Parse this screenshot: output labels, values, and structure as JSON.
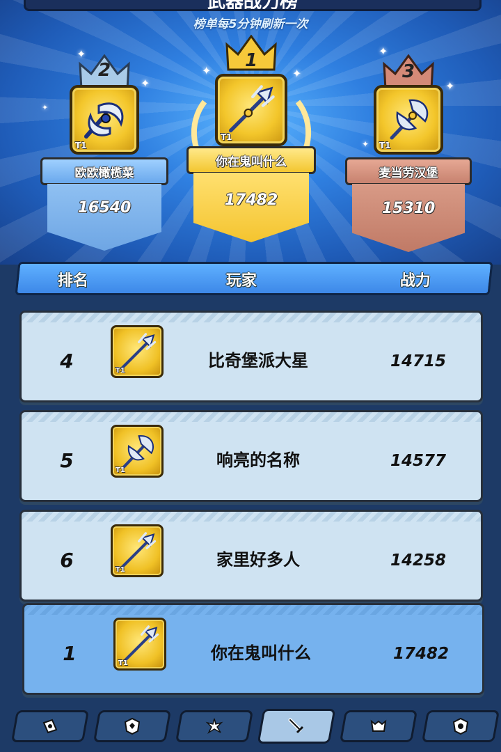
{
  "header": {
    "title": "武器战力榜",
    "subtitle": "榜单每5分钟刷新一次"
  },
  "podium": [
    {
      "rank": "2",
      "name": "欧欧橄榄菜",
      "power": "16540",
      "tier": "T1",
      "theme": "silver"
    },
    {
      "rank": "1",
      "name": "你在鬼叫什么",
      "power": "17482",
      "tier": "T1",
      "theme": "gold"
    },
    {
      "rank": "3",
      "name": "麦当劳汉堡",
      "power": "15310",
      "tier": "T1",
      "theme": "bronze"
    }
  ],
  "columns": {
    "rank": "排名",
    "player": "玩家",
    "power": "战力"
  },
  "rows": [
    {
      "rank": "4",
      "name": "比奇堡派大星",
      "power": "14715",
      "tier": "T1",
      "weapon_icon": "trident-icon"
    },
    {
      "rank": "5",
      "name": "响亮的名称",
      "power": "14577",
      "tier": "T1",
      "weapon_icon": "axe-icon"
    },
    {
      "rank": "6",
      "name": "家里好多人",
      "power": "14258",
      "tier": "T1",
      "weapon_icon": "trident-icon"
    }
  ],
  "my_row": {
    "rank": "1",
    "name": "你在鬼叫什么",
    "power": "17482",
    "tier": "T1",
    "weapon_icon": "trident-icon"
  },
  "tabs": [
    {
      "icon": "card-icon",
      "active": false
    },
    {
      "icon": "shield-badge-icon",
      "active": false
    },
    {
      "icon": "star-burst-icon",
      "active": false
    },
    {
      "icon": "sword-icon",
      "active": true
    },
    {
      "icon": "helmet-icon",
      "active": false
    },
    {
      "icon": "eye-badge-icon",
      "active": false
    }
  ],
  "colors": {
    "gold": "#f7c93a",
    "silver_plate": "#7fb6f0",
    "bronze_plate": "#cf8e7c",
    "row_bg": "#cfe3f2",
    "my_row_bg": "#76b2ee",
    "header_bg": "#3d88e8"
  }
}
